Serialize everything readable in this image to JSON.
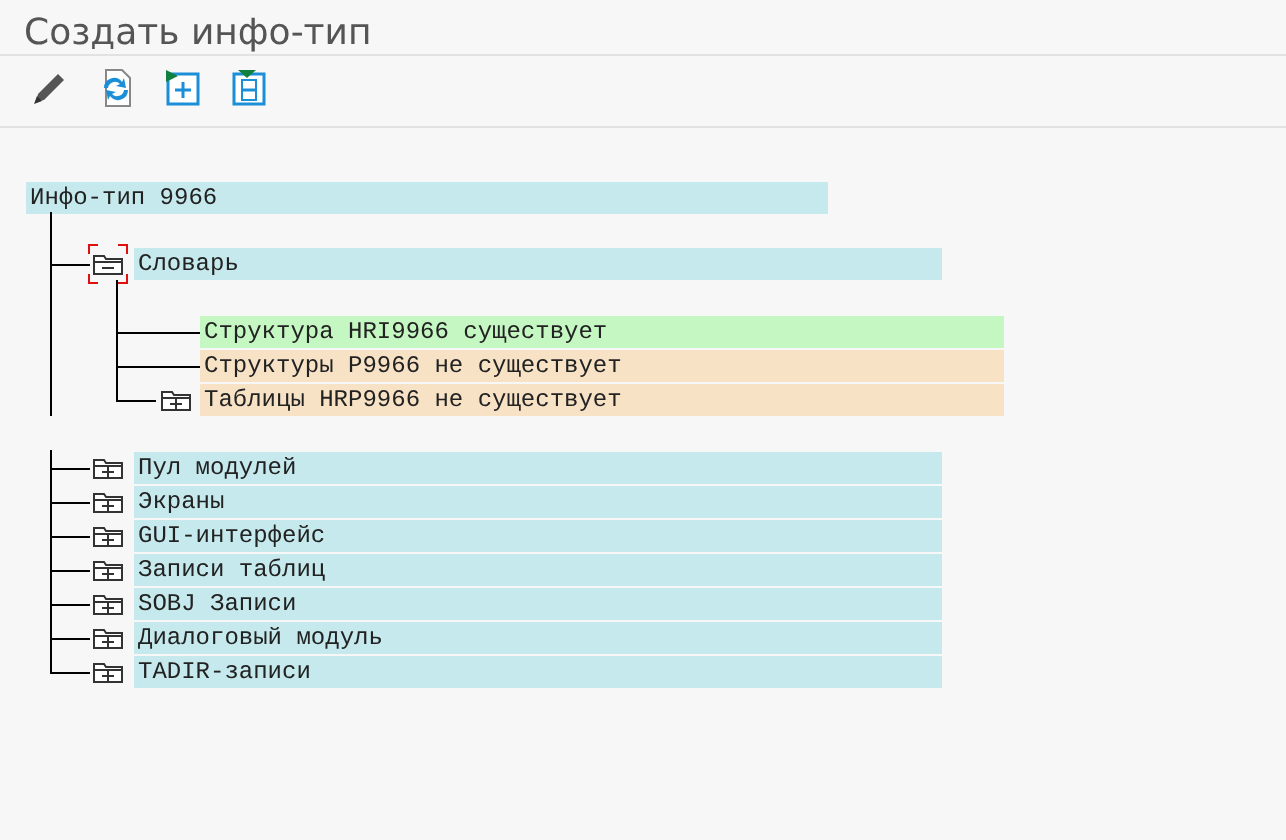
{
  "window": {
    "title": "Создать инфо-тип"
  },
  "toolbar": [
    {
      "kind": "edit"
    },
    {
      "kind": "refresh"
    },
    {
      "kind": "expand"
    },
    {
      "kind": "collapse"
    }
  ],
  "tree": {
    "label": "Инфо-тип 9966",
    "children": [
      {
        "label": "Словарь",
        "expanded": true,
        "selected": true,
        "children": [
          {
            "label": "Структура HRI9966 существует",
            "kind": "message",
            "color": "#c5f7c2"
          },
          {
            "label": "Структуры P9966 не существует",
            "kind": "message",
            "color": "#f7e2c6"
          },
          {
            "label": "Таблицы HRP9966 не существует",
            "kind": "folder",
            "expanded": false,
            "color": "#f7e2c6"
          }
        ]
      },
      {
        "label": "Пул модулей",
        "expanded": false,
        "selected": false
      },
      {
        "label": "Экраны",
        "expanded": false,
        "selected": false
      },
      {
        "label": "GUI-интерфейс",
        "expanded": false,
        "selected": false
      },
      {
        "label": "Записи таблиц",
        "expanded": false,
        "selected": false
      },
      {
        "label": "SOBJ Записи",
        "expanded": false,
        "selected": false
      },
      {
        "label": "Диалоговый модуль",
        "expanded": false,
        "selected": false
      },
      {
        "label": "TADIR-записи",
        "expanded": false,
        "selected": false
      }
    ]
  }
}
